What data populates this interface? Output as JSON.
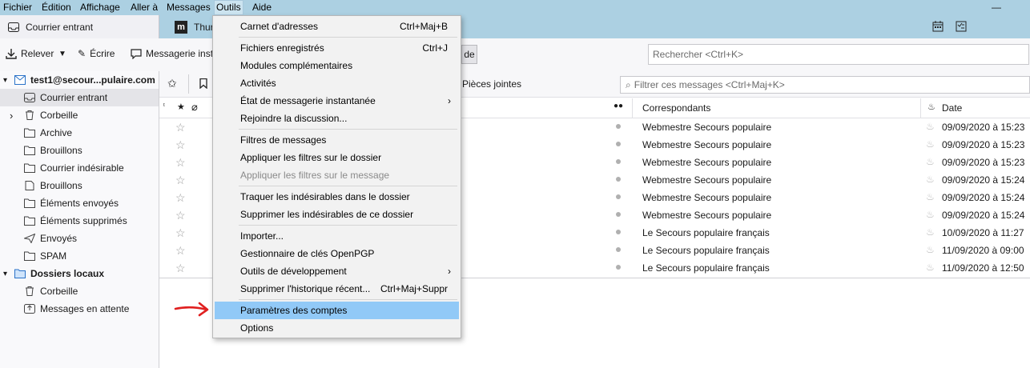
{
  "menubar": {
    "items": [
      "Fichier",
      "Édition",
      "Affichage",
      "Aller à",
      "Messages",
      "Outils",
      "Aide"
    ]
  },
  "tabs": {
    "inbox": "Courrier entrant",
    "thunderbird": "Thur"
  },
  "toolbar": {
    "releve": "Relever",
    "ecrire": "Écrire",
    "messagerie": "Messagerie inst",
    "mode_fragment": "de",
    "search_placeholder": "Rechercher <Ctrl+K>"
  },
  "folders": {
    "account": "test1@secour...pulaire.com",
    "items": [
      "Courrier entrant",
      "Corbeille",
      "Archive",
      "Brouillons",
      "Courrier indésirable",
      "Brouillons",
      "Éléments envoyés",
      "Éléments supprimés",
      "Envoyés",
      "SPAM"
    ],
    "local": "Dossiers locaux",
    "local_items": [
      "Corbeille",
      "Messages en attente"
    ]
  },
  "quickfilter": {
    "attachments": "Pièces jointes",
    "filter_placeholder": "Filtrer ces messages <Ctrl+Maj+K>"
  },
  "columns": {
    "correspondants": "Correspondants",
    "date": "Date"
  },
  "messages": [
    {
      "from": "Webmestre Secours populaire",
      "date": "09/09/2020 à 15:23"
    },
    {
      "from": "Webmestre Secours populaire",
      "date": "09/09/2020 à 15:23"
    },
    {
      "from": "Webmestre Secours populaire",
      "date": "09/09/2020 à 15:23"
    },
    {
      "from": "Webmestre Secours populaire",
      "date": "09/09/2020 à 15:24"
    },
    {
      "from": "Webmestre Secours populaire",
      "date": "09/09/2020 à 15:24"
    },
    {
      "from": "Webmestre Secours populaire",
      "date": "09/09/2020 à 15:24"
    },
    {
      "from": "Le Secours populaire français",
      "date": "10/09/2020 à 11:27"
    },
    {
      "from": "Le Secours populaire français",
      "date": "11/09/2020 à 09:00"
    },
    {
      "from": "Le Secours populaire français",
      "date": "11/09/2020 à 12:50"
    }
  ],
  "dropdown": {
    "items": [
      {
        "label": "Carnet d'adresses",
        "shortcut": "Ctrl+Maj+B"
      },
      {
        "label": "Fichiers enregistrés",
        "shortcut": "Ctrl+J"
      },
      {
        "label": "Modules complémentaires",
        "shortcut": ""
      },
      {
        "label": "Activités",
        "shortcut": ""
      },
      {
        "label": "État de messagerie instantanée",
        "shortcut": ""
      },
      {
        "label": "Rejoindre la discussion...",
        "shortcut": ""
      },
      {
        "label": "Filtres de messages",
        "shortcut": ""
      },
      {
        "label": "Appliquer les filtres sur le dossier",
        "shortcut": ""
      },
      {
        "label": "Appliquer les filtres sur le message",
        "shortcut": ""
      },
      {
        "label": "Traquer les indésirables dans le dossier",
        "shortcut": ""
      },
      {
        "label": "Supprimer les indésirables de ce dossier",
        "shortcut": ""
      },
      {
        "label": "Importer...",
        "shortcut": ""
      },
      {
        "label": "Gestionnaire de clés OpenPGP",
        "shortcut": ""
      },
      {
        "label": "Outils de développement",
        "shortcut": ""
      },
      {
        "label": "Supprimer l'historique récent...",
        "shortcut": "Ctrl+Maj+Suppr"
      },
      {
        "label": "Paramètres des comptes",
        "shortcut": ""
      },
      {
        "label": "Options",
        "shortcut": ""
      }
    ]
  },
  "colors": {
    "menubar_bg": "#acd0e2",
    "highlight": "#91c9f7",
    "annotation_arrow": "#e02020"
  }
}
